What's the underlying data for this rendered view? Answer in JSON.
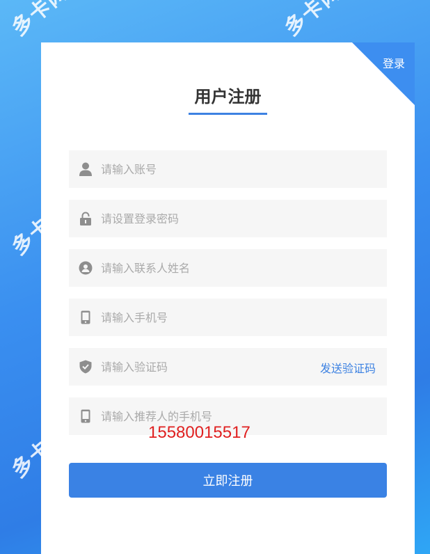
{
  "watermark": "多卡网",
  "header": {
    "login_link": "登录",
    "title": "用户注册"
  },
  "form": {
    "account_placeholder": "请输入账号",
    "password_placeholder": "请设置登录密码",
    "contact_placeholder": "请输入联系人姓名",
    "phone_placeholder": "请输入手机号",
    "code_placeholder": "请输入验证码",
    "send_code_label": "发送验证码",
    "referrer_placeholder": "请输入推荐人的手机号",
    "referrer_overlay_number": "15580015517",
    "submit_label": "立即注册"
  },
  "icons": {
    "account": "user-icon",
    "password": "lock-icon",
    "contact": "contact-person-icon",
    "phone": "mobile-phone-icon",
    "code": "shield-check-icon",
    "referrer": "mobile-phone-icon"
  },
  "colors": {
    "accent": "#3a82e4",
    "overlay_red": "#e02020"
  }
}
